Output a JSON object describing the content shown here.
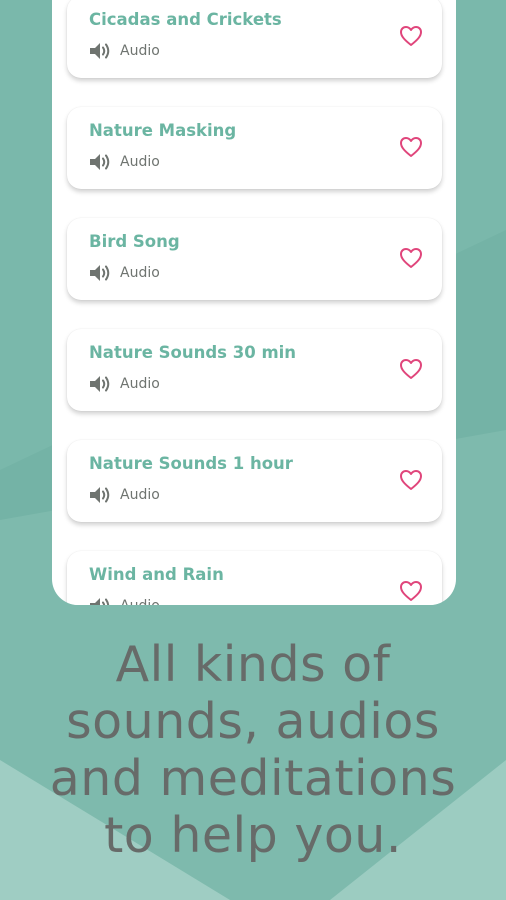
{
  "colors": {
    "background": "#74b3a6",
    "card": "#ffffff",
    "title": "#6bb5a2",
    "subtitle": "#6f7470",
    "heart": "#e0457b",
    "tagline": "#676b69"
  },
  "sounds": [
    {
      "title": "Cicadas and Crickets",
      "type": "Audio",
      "icon": "speaker-icon",
      "favorite_icon": "heart-outline-icon"
    },
    {
      "title": "Nature Masking",
      "type": "Audio",
      "icon": "speaker-icon",
      "favorite_icon": "heart-outline-icon"
    },
    {
      "title": "Bird Song",
      "type": "Audio",
      "icon": "speaker-icon",
      "favorite_icon": "heart-outline-icon"
    },
    {
      "title": "Nature Sounds 30 min",
      "type": "Audio",
      "icon": "speaker-icon",
      "favorite_icon": "heart-outline-icon"
    },
    {
      "title": "Nature Sounds 1 hour",
      "type": "Audio",
      "icon": "speaker-icon",
      "favorite_icon": "heart-outline-icon"
    },
    {
      "title": "Wind and Rain",
      "type": "Audio",
      "icon": "speaker-icon",
      "favorite_icon": "heart-outline-icon"
    }
  ],
  "tagline": {
    "line1": "All kinds of",
    "line2": "sounds, audios",
    "line3": "and meditations",
    "line4": "to help you."
  }
}
